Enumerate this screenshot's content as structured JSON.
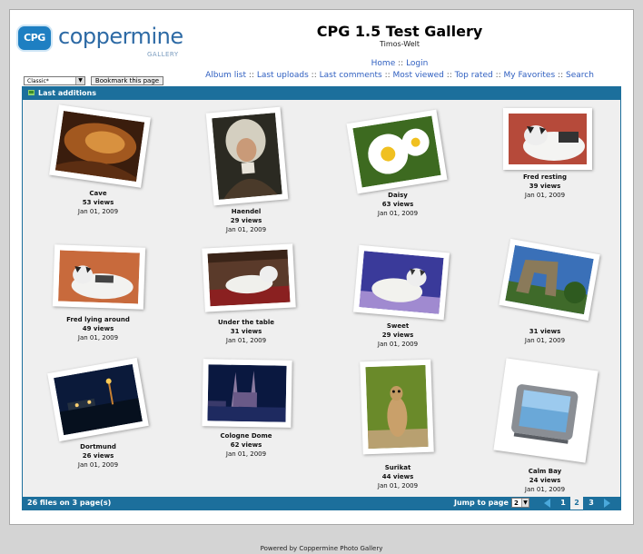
{
  "header": {
    "logo_text": "coppermine",
    "logo_badge": "CPG",
    "logo_sub": "GALLERY",
    "title": "CPG 1.5 Test Gallery",
    "subtitle": "Timos-Welt"
  },
  "nav_primary": [
    "Home",
    "Login"
  ],
  "nav_secondary": [
    "Album list",
    "Last uploads",
    "Last comments",
    "Most viewed",
    "Top rated",
    "My Favorites",
    "Search"
  ],
  "controls": {
    "theme_value": "Classic*",
    "bookmark_label": "Bookmark this page"
  },
  "panel": {
    "title": "Last additions",
    "file_count": "26 files on 3 page(s)",
    "jump_label": "Jump to page",
    "jump_value": "2",
    "pages": [
      "1",
      "2",
      "3"
    ],
    "current_page": "2"
  },
  "items": [
    {
      "name": "Cave",
      "views": "53 views",
      "date": "Jan 01, 2009"
    },
    {
      "name": "Haendel",
      "views": "29 views",
      "date": "Jan 01, 2009"
    },
    {
      "name": "Daisy",
      "views": "63 views",
      "date": "Jan 01, 2009"
    },
    {
      "name": "Fred resting",
      "views": "39 views",
      "date": "Jan 01, 2009"
    },
    {
      "name": "Fred lying around",
      "views": "49 views",
      "date": "Jan 01, 2009"
    },
    {
      "name": "Under the table",
      "views": "31 views",
      "date": "Jan 01, 2009"
    },
    {
      "name": "Sweet",
      "views": "29 views",
      "date": "Jan 01, 2009"
    },
    {
      "name": "",
      "views": "31 views",
      "date": "Jan 01, 2009"
    },
    {
      "name": "Dortmund",
      "views": "26 views",
      "date": "Jan 01, 2009"
    },
    {
      "name": "Cologne Dome",
      "views": "62 views",
      "date": "Jan 01, 2009"
    },
    {
      "name": "Surikat",
      "views": "44 views",
      "date": "Jan 01, 2009"
    },
    {
      "name": "Calm Bay",
      "views": "24 views",
      "date": "Jan 01, 2009"
    }
  ],
  "footer_text": "Powered by Coppermine Photo Gallery"
}
